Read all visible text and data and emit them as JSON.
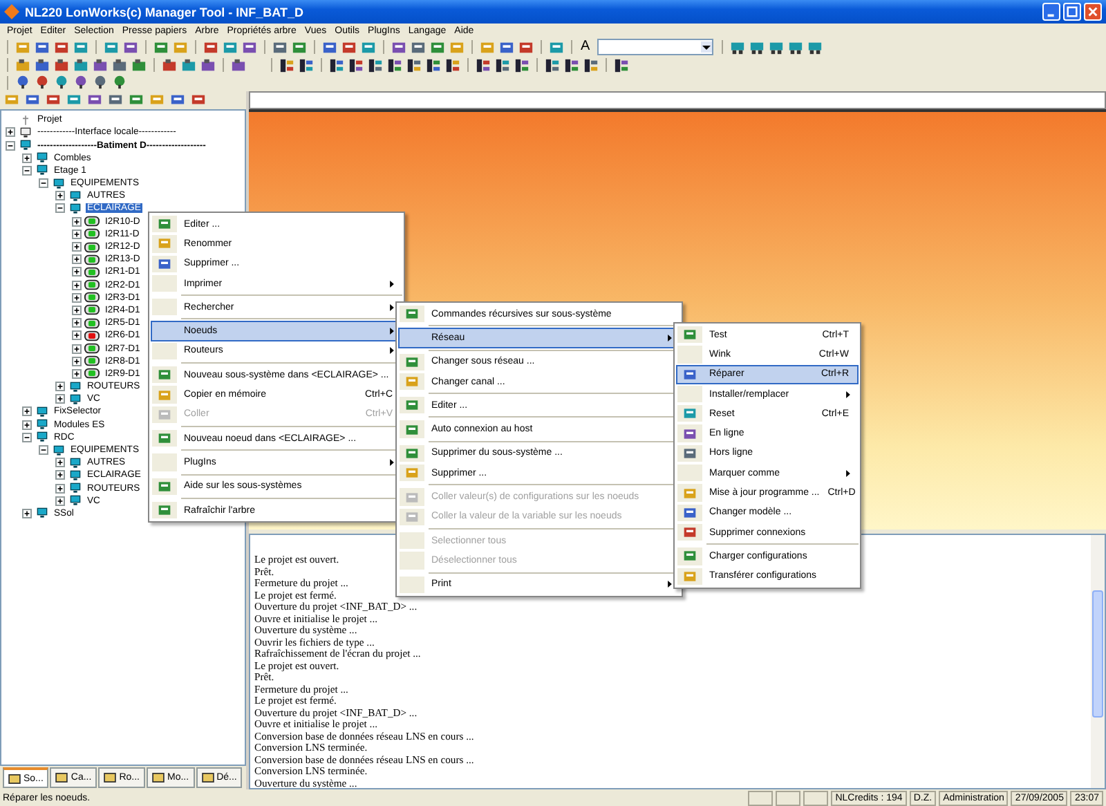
{
  "window": {
    "title": "NL220 LonWorks(c) Manager Tool - INF_BAT_D"
  },
  "menu_bar": [
    "Projet",
    "Editer",
    "Selection",
    "Presse papiers",
    "Arbre",
    "Propriétés arbre",
    "Vues",
    "Outils",
    "PlugIns",
    "Langage",
    "Aide"
  ],
  "toolbar": {
    "font_button": "A"
  },
  "tree": [
    {
      "label": "Projet",
      "kind": "root",
      "selected": false
    },
    {
      "label": "------------Interface locale------------",
      "kind": "interface",
      "expanded": false,
      "selected": false
    },
    {
      "label": "-------------------Batiment D-------------------",
      "kind": "site",
      "expanded": true,
      "selected": false,
      "children": [
        {
          "label": "Combles",
          "kind": "group",
          "expanded": false,
          "selected": false
        },
        {
          "label": "Etage 1",
          "kind": "group",
          "expanded": true,
          "selected": false,
          "children": [
            {
              "label": "EQUIPEMENTS",
              "kind": "group",
              "expanded": true,
              "selected": false,
              "children": [
                {
                  "label": "AUTRES",
                  "kind": "group",
                  "expanded": false,
                  "selected": false
                },
                {
                  "label": "ECLAIRAGE",
                  "kind": "group",
                  "expanded": true,
                  "selected": true,
                  "children": [
                    {
                      "label": "I2R10-D",
                      "kind": "node",
                      "expanded": false,
                      "selected": false,
                      "color": "#22c022"
                    },
                    {
                      "label": "I2R11-D",
                      "kind": "node",
                      "expanded": false,
                      "selected": false,
                      "color": "#22c022"
                    },
                    {
                      "label": "I2R12-D",
                      "kind": "node",
                      "expanded": false,
                      "selected": false,
                      "color": "#22c022"
                    },
                    {
                      "label": "I2R13-D",
                      "kind": "node",
                      "expanded": false,
                      "selected": false,
                      "color": "#22c022"
                    },
                    {
                      "label": "I2R1-D1",
                      "kind": "node",
                      "expanded": false,
                      "selected": false,
                      "color": "#22c022"
                    },
                    {
                      "label": "I2R2-D1",
                      "kind": "node",
                      "expanded": false,
                      "selected": false,
                      "color": "#22c022"
                    },
                    {
                      "label": "I2R3-D1",
                      "kind": "node",
                      "expanded": false,
                      "selected": false,
                      "color": "#22c022"
                    },
                    {
                      "label": "I2R4-D1",
                      "kind": "node",
                      "expanded": false,
                      "selected": false,
                      "color": "#22c022"
                    },
                    {
                      "label": "I2R5-D1",
                      "kind": "node",
                      "expanded": false,
                      "selected": false,
                      "color": "#22c022"
                    },
                    {
                      "label": "I2R6-D1",
                      "kind": "node",
                      "expanded": false,
                      "selected": false,
                      "color": "#e01010"
                    },
                    {
                      "label": "I2R7-D1",
                      "kind": "node",
                      "expanded": false,
                      "selected": false,
                      "color": "#22c022"
                    },
                    {
                      "label": "I2R8-D1",
                      "kind": "node",
                      "expanded": false,
                      "selected": false,
                      "color": "#22c022"
                    },
                    {
                      "label": "I2R9-D1",
                      "kind": "node",
                      "expanded": false,
                      "selected": false,
                      "color": "#22c022"
                    }
                  ]
                },
                {
                  "label": "ROUTEURS",
                  "kind": "group",
                  "expanded": false,
                  "selected": false
                },
                {
                  "label": "VC",
                  "kind": "group",
                  "expanded": false,
                  "selected": false
                }
              ]
            }
          ]
        },
        {
          "label": "FixSelector",
          "kind": "group",
          "expanded": false,
          "selected": false
        },
        {
          "label": "Modules ES",
          "kind": "group",
          "expanded": false,
          "selected": false
        },
        {
          "label": "RDC",
          "kind": "group",
          "expanded": true,
          "selected": false,
          "children": [
            {
              "label": "EQUIPEMENTS",
              "kind": "group",
              "expanded": true,
              "selected": false,
              "children": [
                {
                  "label": "AUTRES",
                  "kind": "group",
                  "expanded": false,
                  "selected": false
                },
                {
                  "label": "ECLAIRAGE",
                  "kind": "group",
                  "expanded": false,
                  "selected": false
                },
                {
                  "label": "ROUTEURS",
                  "kind": "group",
                  "expanded": false,
                  "selected": false
                },
                {
                  "label": "VC",
                  "kind": "group",
                  "expanded": false,
                  "selected": false
                }
              ]
            }
          ]
        },
        {
          "label": "SSol",
          "kind": "group",
          "expanded": false,
          "selected": false
        }
      ]
    }
  ],
  "left_tabs": [
    {
      "label": "So...",
      "selected": true
    },
    {
      "label": "Ca...",
      "selected": false
    },
    {
      "label": "Ro...",
      "selected": false
    },
    {
      "label": "Mo...",
      "selected": false
    },
    {
      "label": "Dé...",
      "selected": false
    }
  ],
  "context_menu": {
    "groups": [
      {
        "items": [
          {
            "label": "Editer ...",
            "has_icon": true,
            "submenu": false,
            "disabled": false,
            "selected": false
          },
          {
            "label": "Renommer",
            "has_icon": true,
            "submenu": false,
            "disabled": false,
            "selected": false
          },
          {
            "label": "Supprimer ...",
            "has_icon": true,
            "submenu": false,
            "disabled": false,
            "selected": false
          },
          {
            "label": "Imprimer",
            "has_icon": false,
            "submenu": true,
            "disabled": false,
            "selected": false
          }
        ]
      },
      {
        "items": [
          {
            "label": "Rechercher",
            "has_icon": false,
            "submenu": true,
            "disabled": false,
            "selected": false
          }
        ]
      },
      {
        "items": [
          {
            "label": "Noeuds",
            "has_icon": false,
            "submenu": true,
            "disabled": false,
            "selected": true
          },
          {
            "label": "Routeurs",
            "has_icon": false,
            "submenu": true,
            "disabled": false,
            "selected": false
          }
        ]
      },
      {
        "items": [
          {
            "label": "Nouveau sous-système dans <ECLAIRAGE> ...",
            "has_icon": true,
            "submenu": false,
            "disabled": false,
            "selected": false
          },
          {
            "label": "Copier en mémoire",
            "shortcut": "Ctrl+C",
            "has_icon": true,
            "submenu": false,
            "disabled": false,
            "selected": false
          },
          {
            "label": "Coller",
            "shortcut": "Ctrl+V",
            "has_icon": true,
            "submenu": false,
            "disabled": true,
            "selected": false
          }
        ]
      },
      {
        "items": [
          {
            "label": "Nouveau noeud dans <ECLAIRAGE> ...",
            "has_icon": true,
            "submenu": false,
            "disabled": false,
            "selected": false
          }
        ]
      },
      {
        "items": [
          {
            "label": "PlugIns",
            "has_icon": false,
            "submenu": true,
            "disabled": false,
            "selected": false
          }
        ]
      },
      {
        "items": [
          {
            "label": "Aide sur les sous-systèmes",
            "has_icon": true,
            "submenu": false,
            "disabled": false,
            "selected": false
          }
        ]
      },
      {
        "items": [
          {
            "label": "Rafraîchir l'arbre",
            "has_icon": true,
            "submenu": false,
            "disabled": false,
            "selected": false
          }
        ]
      }
    ]
  },
  "nodes_menu": {
    "groups": [
      {
        "items": [
          {
            "label": "Commandes récursives sur sous-système",
            "has_icon": true,
            "submenu": false,
            "disabled": false,
            "selected": false
          }
        ]
      },
      {
        "items": [
          {
            "label": "Réseau",
            "has_icon": false,
            "submenu": true,
            "disabled": false,
            "selected": true
          }
        ]
      },
      {
        "items": [
          {
            "label": "Changer sous réseau ...",
            "has_icon": true,
            "submenu": false,
            "disabled": false,
            "selected": false
          },
          {
            "label": "Changer canal ...",
            "has_icon": true,
            "submenu": false,
            "disabled": false,
            "selected": false
          }
        ]
      },
      {
        "items": [
          {
            "label": "Editer ...",
            "has_icon": true,
            "submenu": false,
            "disabled": false,
            "selected": false
          }
        ]
      },
      {
        "items": [
          {
            "label": "Auto connexion au host",
            "has_icon": true,
            "submenu": false,
            "disabled": false,
            "selected": false
          }
        ]
      },
      {
        "items": [
          {
            "label": "Supprimer du sous-système ...",
            "has_icon": true,
            "submenu": false,
            "disabled": false,
            "selected": false
          },
          {
            "label": "Supprimer ...",
            "has_icon": true,
            "submenu": false,
            "disabled": false,
            "selected": false
          }
        ]
      },
      {
        "items": [
          {
            "label": "Coller valeur(s) de configurations sur les noeuds",
            "has_icon": true,
            "submenu": false,
            "disabled": true,
            "selected": false
          },
          {
            "label": "Coller la valeur de la variable sur les noeuds",
            "has_icon": true,
            "submenu": false,
            "disabled": true,
            "selected": false
          }
        ]
      },
      {
        "items": [
          {
            "label": "Selectionner tous",
            "has_icon": false,
            "submenu": false,
            "disabled": true,
            "selected": false
          },
          {
            "label": "Déselectionner tous",
            "has_icon": false,
            "submenu": false,
            "disabled": true,
            "selected": false
          }
        ]
      },
      {
        "items": [
          {
            "label": "Print",
            "has_icon": false,
            "submenu": true,
            "disabled": false,
            "selected": false
          }
        ]
      }
    ]
  },
  "network_menu": {
    "groups": [
      {
        "items": [
          {
            "label": "Test",
            "shortcut": "Ctrl+T",
            "has_icon": true,
            "submenu": false,
            "disabled": false,
            "selected": false
          },
          {
            "label": "Wink",
            "shortcut": "Ctrl+W",
            "has_icon": false,
            "submenu": false,
            "disabled": false,
            "selected": false
          },
          {
            "label": "Réparer",
            "shortcut": "Ctrl+R",
            "has_icon": true,
            "submenu": false,
            "disabled": false,
            "selected": true
          },
          {
            "label": "Installer/remplacer",
            "has_icon": false,
            "submenu": true,
            "disabled": false,
            "selected": false
          },
          {
            "label": "Reset",
            "shortcut": "Ctrl+E",
            "has_icon": true,
            "submenu": false,
            "disabled": false,
            "selected": false
          },
          {
            "label": "En ligne",
            "has_icon": true,
            "submenu": false,
            "disabled": false,
            "selected": false
          },
          {
            "label": "Hors ligne",
            "has_icon": true,
            "submenu": false,
            "disabled": false,
            "selected": false
          },
          {
            "label": "Marquer comme",
            "has_icon": false,
            "submenu": true,
            "disabled": false,
            "selected": false
          },
          {
            "label": "Mise à jour programme ...",
            "shortcut": "Ctrl+D",
            "has_icon": true,
            "submenu": false,
            "disabled": false,
            "selected": false
          },
          {
            "label": "Changer modèle ...",
            "has_icon": true,
            "submenu": false,
            "disabled": false,
            "selected": false
          },
          {
            "label": "Supprimer connexions",
            "has_icon": true,
            "submenu": false,
            "disabled": false,
            "selected": false
          }
        ]
      },
      {
        "items": [
          {
            "label": "Charger configurations",
            "has_icon": true,
            "submenu": false,
            "disabled": false,
            "selected": false
          },
          {
            "label": "Transférer configurations",
            "has_icon": true,
            "submenu": false,
            "disabled": false,
            "selected": false
          }
        ]
      }
    ]
  },
  "log": [
    "Le projet est ouvert.",
    "Prêt.",
    "Fermeture du projet ...",
    "Le projet est fermé.",
    "Ouverture du projet <INF_BAT_D> ...",
    "Ouvre et initialise le projet ...",
    "Ouverture du système ...",
    "Ouvrir les fichiers de type ...",
    "Rafraîchissement de l'écran du projet  ...",
    "Le projet est ouvert.",
    "Prêt.",
    "Fermeture du projet ...",
    "Le projet est fermé.",
    "Ouverture du projet <INF_BAT_D> ...",
    "Ouvre et initialise le projet ...",
    "Conversion base de données réseau LNS en cours ...",
    "Conversion LNS terminée.",
    "Conversion base de données réseau LNS en cours ...",
    "Conversion LNS terminée.",
    "Ouverture du système ..."
  ],
  "status_bar": {
    "message": "Réparer les noeuds.",
    "credits": "NLCredits : 194",
    "user": "D.Z.",
    "role": "Administration",
    "date": "27/09/2005",
    "time": "23:07"
  }
}
